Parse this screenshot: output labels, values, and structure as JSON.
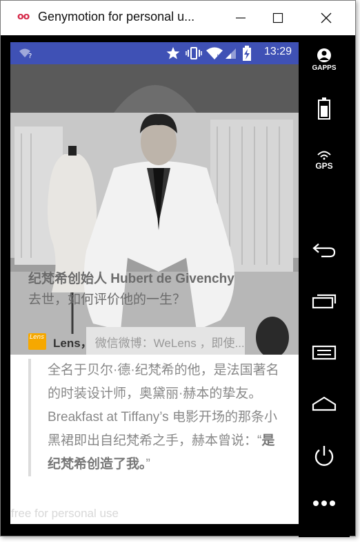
{
  "window": {
    "title": "Genymotion for personal u...",
    "logo_text": "oo"
  },
  "statusbar": {
    "time": "13:29",
    "bg_color": "#3f51b5"
  },
  "article": {
    "headline_line1": "纪梵希创始人 Hubert de Givenchy",
    "headline_line2": "去世，如何评价他的一生？",
    "source_logo_text": "Lens",
    "source_name": "Lens，",
    "source_desc": "微信微博：WeLens ，即使...",
    "quote_text": "全名于贝尔·德·纪梵希的他，是法国著名的时装设计师，奥黛丽·赫本的挚友。Breakfast at Tiffany’s 电影开场的那条小黑裙即出自纪梵希之手，赫本曾说：“",
    "quote_bold": "是纪梵希创造了我。",
    "quote_end": "”"
  },
  "watermark": "free for personal use",
  "sidebar": {
    "gapps_label": "GAPPS",
    "gps_label": "GPS"
  },
  "icons": [
    "genymotion-logo-icon",
    "minimize-icon",
    "maximize-icon",
    "close-icon",
    "wifi-question-icon",
    "star-icon",
    "vibrate-icon",
    "wifi-icon",
    "signal-icon",
    "battery-charging-icon",
    "gapps-icon",
    "battery-icon",
    "gps-icon",
    "back-icon",
    "recent-apps-icon",
    "menu-icon",
    "home-icon",
    "power-icon",
    "more-icon"
  ]
}
